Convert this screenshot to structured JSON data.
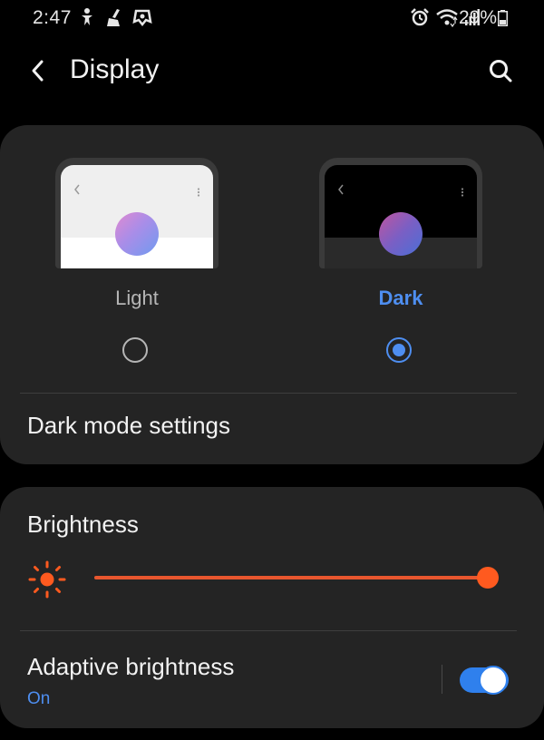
{
  "status_bar": {
    "time": "2:47",
    "battery_percent": "29%",
    "left_icons": [
      "accessibility-icon",
      "cleaning-icon",
      "game-icon"
    ],
    "right_icons": [
      "alarm-icon",
      "wifi-icon",
      "signal-icon",
      "battery-icon"
    ]
  },
  "app_bar": {
    "title": "Display",
    "back_icon": "back-arrow-icon",
    "search_icon": "search-icon"
  },
  "theme_card": {
    "options": [
      {
        "label": "Light",
        "selected": false
      },
      {
        "label": "Dark",
        "selected": true
      }
    ],
    "dark_mode_settings_label": "Dark mode settings"
  },
  "brightness_card": {
    "title": "Brightness",
    "brightness_level": 1.0,
    "adaptive": {
      "title": "Adaptive brightness",
      "status": "On",
      "enabled": true
    }
  },
  "colors": {
    "accent_blue": "#4e8ef0",
    "slider_orange": "#e8562e",
    "card_bg": "#242424",
    "background": "#000000"
  }
}
